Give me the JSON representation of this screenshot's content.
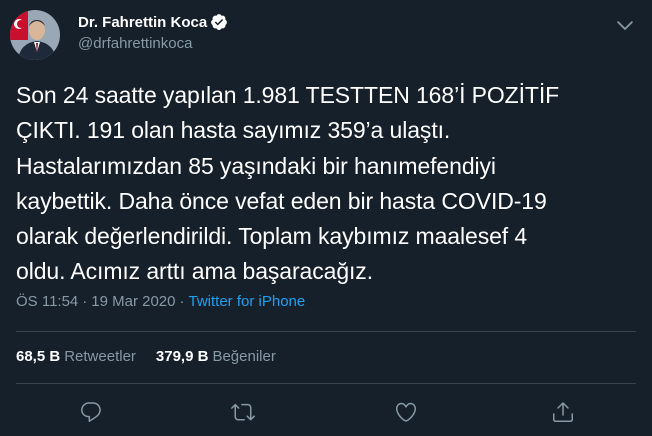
{
  "author": {
    "display_name": "Dr. Fahrettin Koca",
    "handle": "@drfahrettinkoca",
    "verified": true
  },
  "tweet": {
    "text": "Son 24 saatte yapılan 1.981 TESTTEN 168’İ POZİTİF\nÇIKTI. 191 olan hasta sayımız 359’a ulaştı.\nHastalarımızdan 85 yaşındaki bir hanımefendiyi\nkaybettik. Daha önce vefat eden bir hasta COVID-19\nolarak değerlendirildi. Toplam kaybımız maalesef 4\noldu. Acımız arttı ama başaracağız.",
    "time": "ÖS 11:54",
    "separator": "·",
    "date": "19 Mar 2020",
    "source": "Twitter for iPhone"
  },
  "stats": {
    "retweets_count": "68,5 B",
    "retweets_label": "Retweetler",
    "likes_count": "379,9 B",
    "likes_label": "Beğeniler"
  },
  "icons": {
    "more": "chevron-down-icon",
    "reply": "reply-icon",
    "retweet": "retweet-icon",
    "like": "heart-icon",
    "share": "share-icon"
  },
  "colors": {
    "background": "#15202b",
    "text": "#ffffff",
    "secondary": "#8899a6",
    "accent": "#1da1f2",
    "divider": "#38444d"
  }
}
